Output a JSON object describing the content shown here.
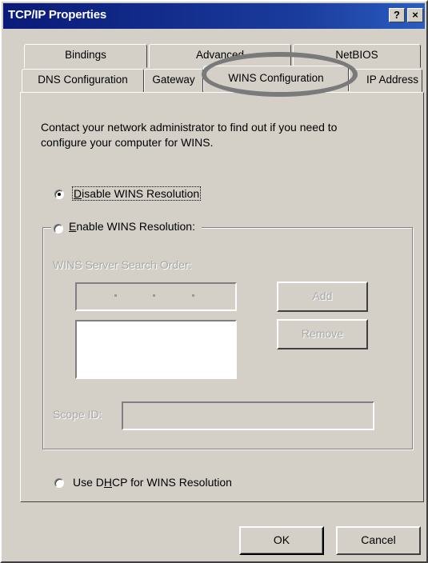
{
  "window": {
    "title": "TCP/IP Properties",
    "help_button": "?",
    "close_button": "×"
  },
  "tabs": {
    "row1": [
      {
        "label": "Bindings"
      },
      {
        "label": "Advanced"
      },
      {
        "label": "NetBIOS"
      }
    ],
    "row2": [
      {
        "label": "DNS Configuration"
      },
      {
        "label": "Gateway"
      },
      {
        "label": "WINS Configuration",
        "active": true
      },
      {
        "label": "IP Address"
      }
    ]
  },
  "panel": {
    "info_line1": "Contact your network administrator to find out if you need to",
    "info_line2": "configure your computer for WINS.",
    "options": {
      "disable": {
        "prefix": "",
        "accel": "D",
        "rest": "isable WINS Resolution",
        "selected": true
      },
      "enable": {
        "prefix": "",
        "accel": "E",
        "rest": "nable WINS Resolution:",
        "selected": false
      },
      "dhcp": {
        "prefix": "Use D",
        "accel": "H",
        "rest": "CP for WINS Resolution",
        "selected": false
      }
    },
    "server_search_label": "WINS Server Search Order:",
    "add_button": "Add",
    "remove_button": "Remove",
    "scope_id_label": "Scope ID:"
  },
  "footer": {
    "ok_button": "OK",
    "cancel_button": "Cancel"
  },
  "colors": {
    "titlebar": "#0a1a78",
    "dialog_face": "#d4d0c8",
    "highlight_ring": "#7a7a7a"
  }
}
